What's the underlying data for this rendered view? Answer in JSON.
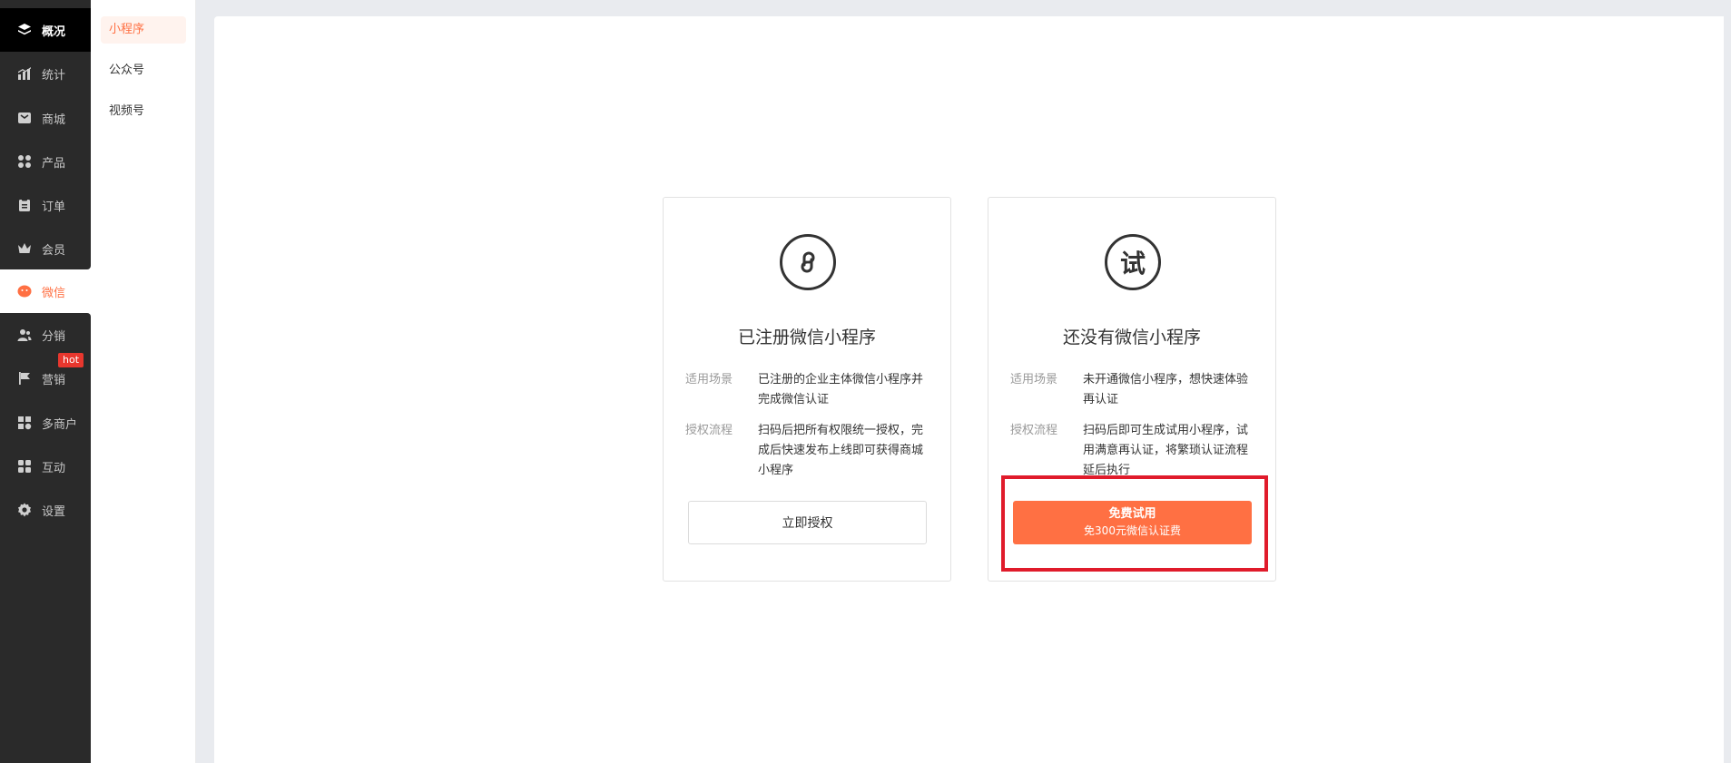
{
  "sidebar": {
    "items": [
      {
        "label": "概况",
        "icon": "layers-icon"
      },
      {
        "label": "统计",
        "icon": "chart-icon"
      },
      {
        "label": "商城",
        "icon": "mail-icon"
      },
      {
        "label": "产品",
        "icon": "grid-icon"
      },
      {
        "label": "订单",
        "icon": "clipboard-icon"
      },
      {
        "label": "会员",
        "icon": "crown-icon"
      },
      {
        "label": "微信",
        "icon": "wechat-icon"
      },
      {
        "label": "分销",
        "icon": "users-icon"
      },
      {
        "label": "营销",
        "icon": "flag-icon"
      },
      {
        "label": "多商户",
        "icon": "store-icon"
      },
      {
        "label": "互动",
        "icon": "blocks-icon"
      },
      {
        "label": "设置",
        "icon": "gear-icon"
      }
    ],
    "hot_badge": "hot",
    "active_color": "#ff7043"
  },
  "subnav": {
    "items": [
      {
        "label": "小程序"
      },
      {
        "label": "公众号"
      },
      {
        "label": "视频号"
      }
    ]
  },
  "cards": [
    {
      "icon": "mini-program-icon",
      "title": "已注册微信小程序",
      "rows": [
        {
          "key": "适用场景",
          "value": "已注册的企业主体微信小程序并完成微信认证"
        },
        {
          "key": "授权流程",
          "value": "扫码后把所有权限统一授权，完成后快速发布上线即可获得商城小程序"
        }
      ],
      "button": "立即授权"
    },
    {
      "icon": "trial-icon",
      "icon_text": "试",
      "title": "还没有微信小程序",
      "rows": [
        {
          "key": "适用场景",
          "value": "未开通微信小程序，想快速体验再认证"
        },
        {
          "key": "授权流程",
          "value": "扫码后即可生成试用小程序，试用满意再认证，将繁琐认证流程延后执行"
        }
      ],
      "button_line1": "免费试用",
      "button_line2": "免300元微信认证费"
    }
  ],
  "colors": {
    "primary": "#ff7043",
    "sidebar_dark": "#2a2a2a",
    "highlight_border": "#e01b2b"
  }
}
